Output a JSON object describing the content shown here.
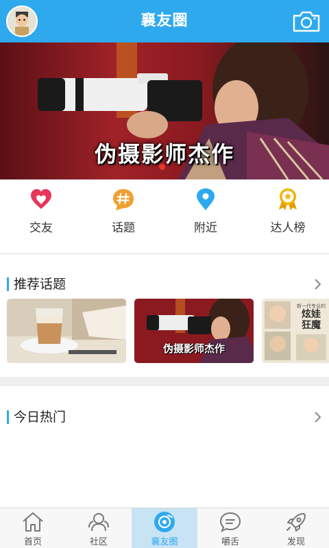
{
  "header": {
    "title": "襄友圈",
    "accent_color": "#2fa9ee"
  },
  "banner": {
    "caption": "伪摄影师杰作"
  },
  "quick_nav": [
    {
      "label": "交友",
      "icon": "heart-icon",
      "color": "#e8355a"
    },
    {
      "label": "话题",
      "icon": "hashtag-icon",
      "color": "#f0a030"
    },
    {
      "label": "附近",
      "icon": "location-pin-icon",
      "color": "#2fa9ee"
    },
    {
      "label": "达人榜",
      "icon": "medal-icon",
      "color": "#f0b400"
    }
  ],
  "sections": {
    "recommended": {
      "title": "推荐话题"
    },
    "today_hot": {
      "title": "今日热门"
    }
  },
  "topics": [
    {
      "name": "coffee-latte-image"
    },
    {
      "name": "photographer-image",
      "caption": "伪摄影师杰作"
    },
    {
      "name": "baby-collage-image",
      "caption_top": "炫娃",
      "caption_bottom": "狂魔",
      "small": "新一代专业的"
    }
  ],
  "tabbar": {
    "active_index": 2,
    "tabs": [
      {
        "label": "首页",
        "icon": "home-icon"
      },
      {
        "label": "社区",
        "icon": "community-icon"
      },
      {
        "label": "襄友圈",
        "icon": "friend-circle-icon"
      },
      {
        "label": "嚼舌",
        "icon": "chat-bubble-icon"
      },
      {
        "label": "发现",
        "icon": "rocket-icon"
      }
    ]
  }
}
